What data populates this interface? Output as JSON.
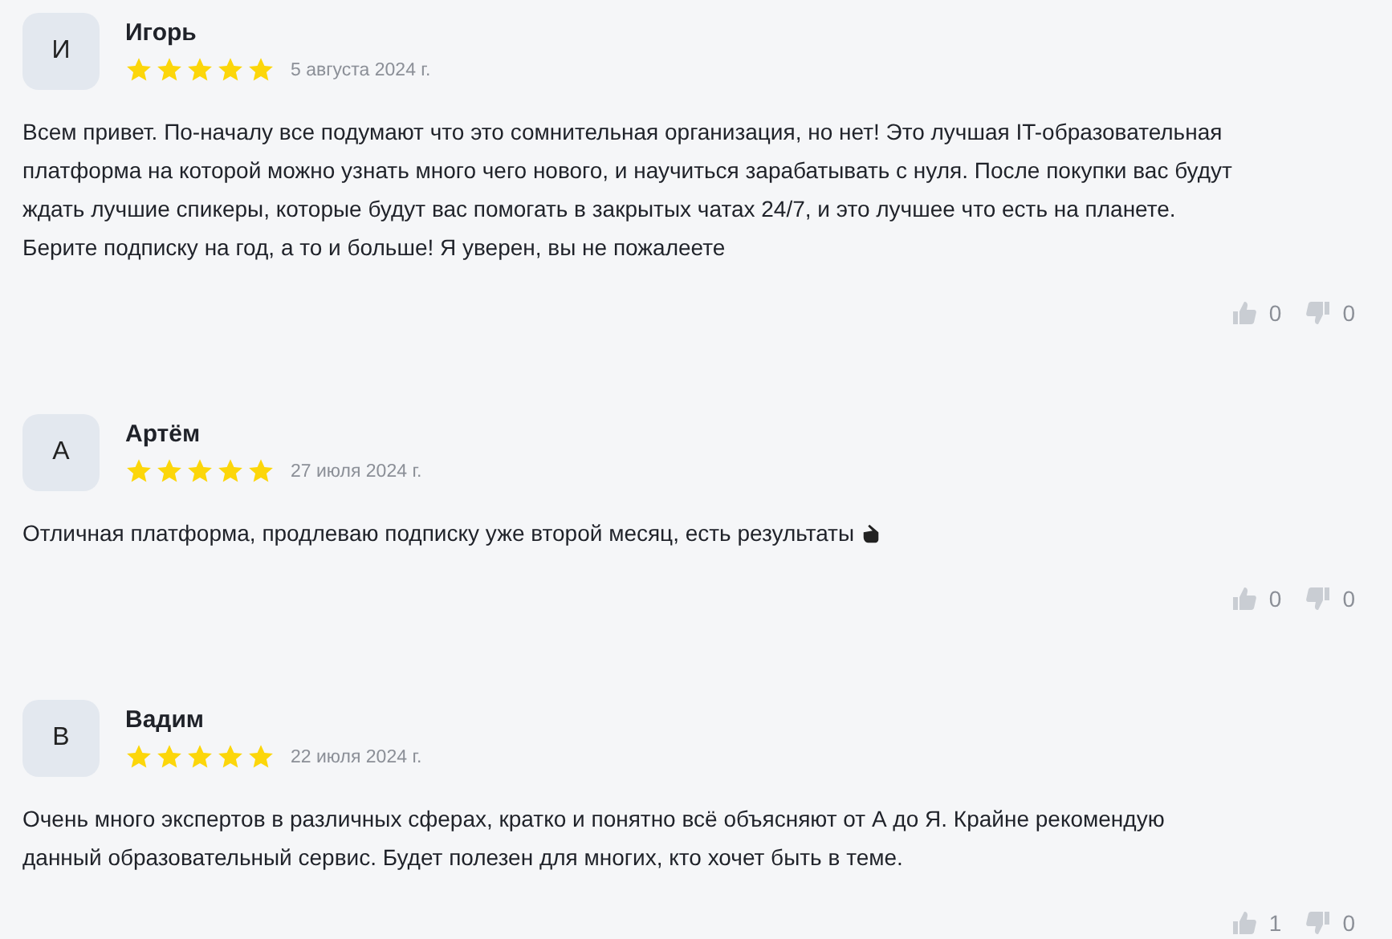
{
  "reviews": [
    {
      "initial": "И",
      "name": "Игорь",
      "stars": 5,
      "date": "5 августа 2024 г.",
      "text": "Всем привет. По-началу все подумают что это сомнительная организация, но нет! Это лучшая IT-образовательная платформа на которой можно узнать много чего нового, и научиться зарабатывать с нуля. После покупки вас будут ждать лучшие спикеры, которые будут вас помогать в закрытых чатах 24/7, и это лучшее что есть на планете. Берите подписку на год, а то и больше! Я уверен, вы не пожалеете",
      "emoji": false,
      "likes": "0",
      "dislikes": "0"
    },
    {
      "initial": "А",
      "name": "Артём",
      "stars": 5,
      "date": "27 июля 2024 г.",
      "text": "Отличная платформа, продлеваю подписку уже второй месяц, есть результаты",
      "emoji": true,
      "likes": "0",
      "dislikes": "0"
    },
    {
      "initial": "В",
      "name": "Вадим",
      "stars": 5,
      "date": "22 июля 2024 г.",
      "text": "Очень много экспертов в различных сферах, кратко и понятно всё объясняют от А до Я. Крайне рекомендую данный образовательный сервис. Будет полезен для многих, кто хочет быть в теме.",
      "emoji": false,
      "likes": "1",
      "dislikes": "0"
    }
  ]
}
